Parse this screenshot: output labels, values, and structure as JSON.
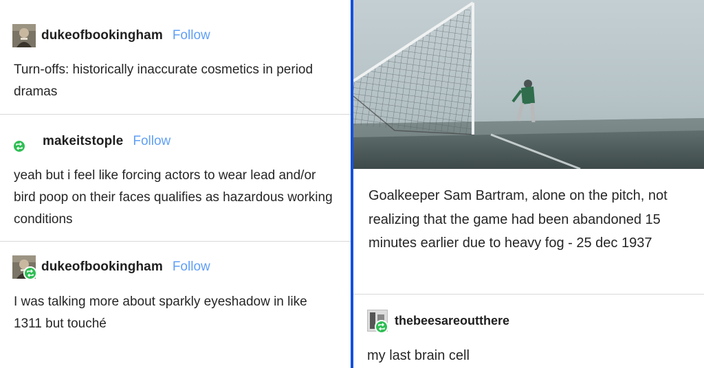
{
  "left_thread": [
    {
      "username": "dukeofbookingham",
      "follow_label": "Follow",
      "reblogged": false,
      "text": "Turn-offs: historically inaccurate cosmetics in period dramas"
    },
    {
      "username": "makeitstople",
      "follow_label": "Follow",
      "reblogged": true,
      "text": "yeah but i feel like forcing actors to wear lead and/or bird poop on their faces qualifies as hazardous working conditions"
    },
    {
      "username": "dukeofbookingham",
      "follow_label": "Follow",
      "reblogged": true,
      "text": "I was talking more about sparkly eyeshadow in like 1311 but touché"
    }
  ],
  "right_post": {
    "photo_alt_icon": "foggy-football-pitch-photo",
    "caption": "Goalkeeper Sam Bartram, alone on the pitch, not realizing that the game had been abandoned 15 minutes earlier due to heavy fog - 25 dec 1937",
    "reply": {
      "username": "thebeesareoutthere",
      "reblogged": true,
      "text": "my last brain cell"
    }
  },
  "colors": {
    "divider": "#1450e0",
    "follow": "#5f9ff5",
    "reblog_badge": "#2fbe55"
  }
}
